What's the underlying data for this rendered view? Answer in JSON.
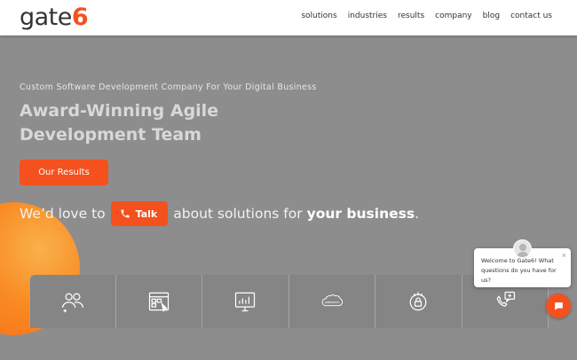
{
  "brand": {
    "name_part": "gate",
    "name_accent": "6",
    "accent_color": "#f4511e"
  },
  "nav": {
    "items": [
      "solutions",
      "industries",
      "results",
      "company",
      "blog",
      "contact us"
    ]
  },
  "hero": {
    "kicker": "Custom Software Development Company For Your Digital Business",
    "headline": "Award-Winning Agile Development Team",
    "results_button": "Our Results",
    "talk_prefix": "We’d love to",
    "talk_button": "Talk",
    "talk_middle": "about solutions for",
    "talk_bold": "your business",
    "talk_suffix": "."
  },
  "services": {
    "icons": [
      "team-icon",
      "web-app-icon",
      "dashboard-icon",
      "salesforce-icon",
      "security-icon",
      "support-icon"
    ],
    "salesforce_label": "salesforce"
  },
  "chat": {
    "message": "Welcome to Gate6! What questions do you have for us?",
    "close": "×"
  }
}
